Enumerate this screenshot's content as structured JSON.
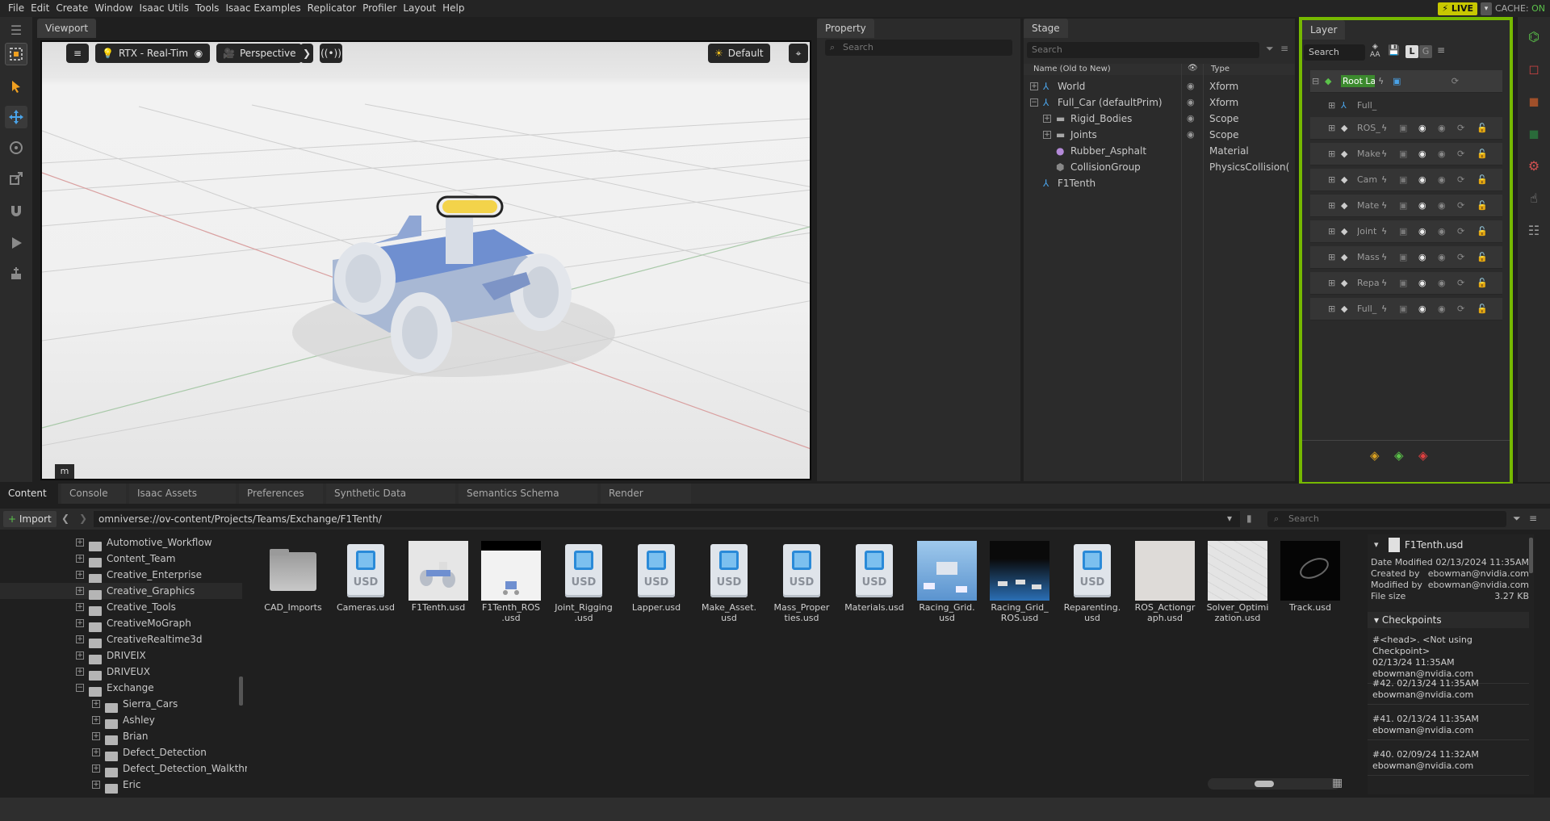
{
  "menu": [
    "File",
    "Edit",
    "Create",
    "Window",
    "Isaac Utils",
    "Tools",
    "Isaac Examples",
    "Replicator",
    "Profiler",
    "Layout",
    "Help"
  ],
  "status": {
    "live": "⚡ LIVE",
    "cache_label": "CACHE:",
    "cache_state": "ON"
  },
  "viewport": {
    "tab": "Viewport",
    "renderer": "RTX - Real-Time",
    "camera": "Perspective",
    "lighting": "Default",
    "hotkey_badge": "m"
  },
  "property": {
    "tab": "Property",
    "search_placeholder": "Search"
  },
  "stage": {
    "tab": "Stage",
    "search_placeholder": "Search",
    "col_name": "Name (Old to New)",
    "col_type": "Type",
    "rows": [
      {
        "name": "World",
        "type": "Xform",
        "depth": 0,
        "expander": "+",
        "icon": "xform"
      },
      {
        "name": "Full_Car (defaultPrim)",
        "type": "Xform",
        "depth": 0,
        "expander": "−",
        "icon": "xform"
      },
      {
        "name": "Rigid_Bodies",
        "type": "Scope",
        "depth": 1,
        "expander": "+",
        "icon": "folder"
      },
      {
        "name": "Joints",
        "type": "Scope",
        "depth": 1,
        "expander": "+",
        "icon": "folder"
      },
      {
        "name": "Rubber_Asphalt",
        "type": "Material",
        "depth": 1,
        "expander": "",
        "icon": "material"
      },
      {
        "name": "CollisionGroup",
        "type": "PhysicsCollision(",
        "depth": 1,
        "expander": "",
        "icon": "collision"
      },
      {
        "name": "F1Tenth",
        "type": "",
        "depth": 0,
        "expander": "",
        "icon": "xform"
      }
    ]
  },
  "layer": {
    "tab": "Layer",
    "search_placeholder": "Search",
    "aa_label": "AA",
    "l_label": "L",
    "g_label": "G",
    "root_label": "Root La",
    "sub_label": "Full_",
    "rows": [
      "ROS_",
      "Make",
      "Cam",
      "Mate",
      "Joint",
      "Mass",
      "Repa",
      "Full_"
    ]
  },
  "bottom_tabs": [
    "Content",
    "Console",
    "Isaac Assets (Beta)",
    "Preferences",
    "Synthetic Data Recorder",
    "Semantics Schema Editor",
    "Render Settings"
  ],
  "content": {
    "import_label": "Import",
    "path": "omniverse://ov-content/Projects/Teams/Exchange/F1Tenth/",
    "search_placeholder": "Search",
    "tree": [
      {
        "label": "Automotive_Workflow",
        "depth": 0,
        "open": false
      },
      {
        "label": "Content_Team",
        "depth": 0,
        "open": false
      },
      {
        "label": "Creative_Enterprise",
        "depth": 0,
        "open": false
      },
      {
        "label": "Creative_Graphics",
        "depth": 0,
        "open": false
      },
      {
        "label": "Creative_Tools",
        "depth": 0,
        "open": false
      },
      {
        "label": "CreativeMoGraph",
        "depth": 0,
        "open": false
      },
      {
        "label": "CreativeRealtime3d",
        "depth": 0,
        "open": false
      },
      {
        "label": "DRIVEIX",
        "depth": 0,
        "open": false
      },
      {
        "label": "DRIVEUX",
        "depth": 0,
        "open": false
      },
      {
        "label": "Exchange",
        "depth": 0,
        "open": true
      },
      {
        "label": "Sierra_Cars",
        "depth": 1,
        "open": false
      },
      {
        "label": "Ashley",
        "depth": 1,
        "open": false
      },
      {
        "label": "Brian",
        "depth": 1,
        "open": false
      },
      {
        "label": "Defect_Detection",
        "depth": 1,
        "open": false
      },
      {
        "label": "Defect_Detection_Walkthro",
        "depth": 1,
        "open": false
      },
      {
        "label": "Eric",
        "depth": 1,
        "open": false
      }
    ],
    "files": [
      {
        "l1": "CAD_Imports",
        "l2": "",
        "kind": "folder"
      },
      {
        "l1": "Cameras.usd",
        "l2": "",
        "kind": "usd"
      },
      {
        "l1": "F1Tenth.usd",
        "l2": "",
        "kind": "car"
      },
      {
        "l1": "F1Tenth_ROS",
        "l2": ".usd",
        "kind": "car-dark"
      },
      {
        "l1": "Joint_Rigging",
        "l2": ".usd",
        "kind": "usd"
      },
      {
        "l1": "Lapper.usd",
        "l2": "",
        "kind": "usd"
      },
      {
        "l1": "Make_Asset.",
        "l2": "usd",
        "kind": "usd"
      },
      {
        "l1": "Mass_Proper",
        "l2": "ties.usd",
        "kind": "usd"
      },
      {
        "l1": "Materials.usd",
        "l2": "",
        "kind": "usd"
      },
      {
        "l1": "Racing_Grid.",
        "l2": "usd",
        "kind": "racing"
      },
      {
        "l1": "Racing_Grid_",
        "l2": "ROS.usd",
        "kind": "racing-dark"
      },
      {
        "l1": "Reparenting.",
        "l2": "usd",
        "kind": "usd"
      },
      {
        "l1": "ROS_Actiongr",
        "l2": "aph.usd",
        "kind": "plain"
      },
      {
        "l1": "Solver_Optimi",
        "l2": "zation.usd",
        "kind": "grid"
      },
      {
        "l1": "Track.usd",
        "l2": "",
        "kind": "track"
      }
    ],
    "detail": {
      "filename": "F1Tenth.usd",
      "date_modified_label": "Date Modified",
      "date_modified": "02/13/2024 11:35AM",
      "created_by_label": "Created by",
      "created_by": "ebowman@nvidia.com",
      "modified_by_label": "Modified by",
      "modified_by": "ebowman@nvidia.com",
      "file_size_label": "File size",
      "file_size": "3.27 KB",
      "checkpoints_label": "Checkpoints",
      "checkpoints": [
        {
          "line1": "#<head>.   <Not using Checkpoint>",
          "line2": "02/13/24 11:35AM",
          "line3": "ebowman@nvidia.com"
        },
        {
          "line1": "#42.   02/13/24 11:35AM",
          "line2": "ebowman@nvidia.com",
          "line3": ""
        },
        {
          "line1": "#41.   02/13/24 11:35AM",
          "line2": "ebowman@nvidia.com",
          "line3": ""
        },
        {
          "line1": "#40.   02/09/24 11:32AM",
          "line2": "ebowman@nvidia.com",
          "line3": ""
        }
      ]
    }
  },
  "colors": {
    "accent": "#76b900",
    "live": "#c8c800",
    "panel": "#2b2b2b",
    "usd_blue": "#2a8ad8"
  }
}
